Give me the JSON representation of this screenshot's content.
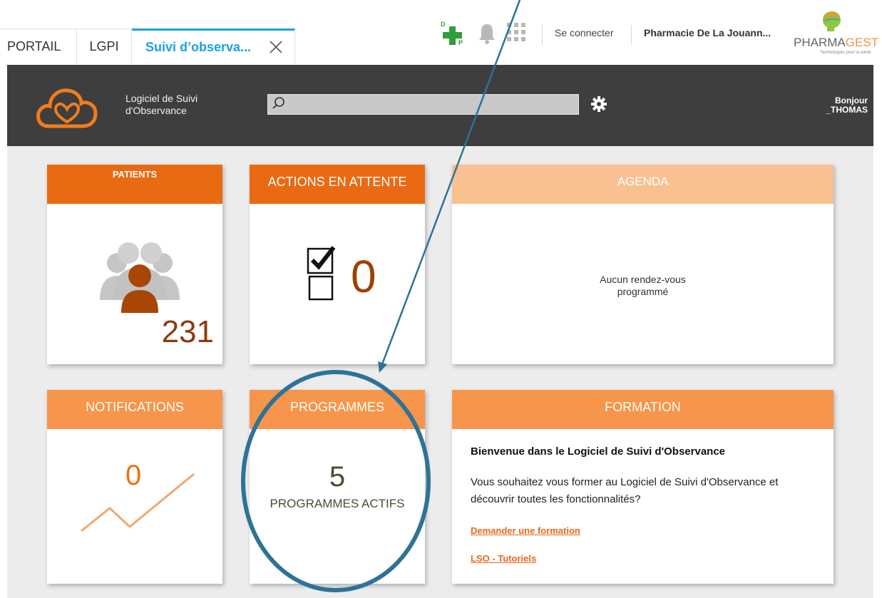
{
  "tabs": [
    {
      "label": "PORTAIL"
    },
    {
      "label": "LGPI"
    },
    {
      "label": "Suivi d’observa..."
    }
  ],
  "topbar": {
    "connect": "Se connecter",
    "pharmacy": "Pharmacie De La Jouann...",
    "logo_main": "PHARMA",
    "logo_accent": "GEST",
    "logo_sub": "Technologies pour la santé",
    "dp_letters": "D P"
  },
  "app": {
    "title_line1": "Logiciel de Suivi",
    "title_line2": "d'Observance",
    "search_value": "",
    "greeting": "Bonjour",
    "user": "_THOMAS"
  },
  "cards": {
    "patients": {
      "title": "PATIENTS",
      "count": "231"
    },
    "actions": {
      "title": "ACTIONS EN ATTENTE",
      "count": "0"
    },
    "agenda": {
      "title": "AGENDA",
      "message_line1": "Aucun rendez-vous",
      "message_line2": "programmé"
    },
    "notifications": {
      "title": "NOTIFICATIONS",
      "count": "0"
    },
    "programmes": {
      "title": "PROGRAMMES",
      "count": "5",
      "label": "PROGRAMMES ACTIFS"
    },
    "formation": {
      "title": "FORMATION",
      "heading": "Bienvenue dans le Logiciel de Suivi d'Observance",
      "text": "Vous souhaitez vous former au Logiciel de Suivi d'Observance et découvrir toutes les fonctionnalités?",
      "link1": "Demander une formation",
      "link2": "LSO - Tutoriels"
    }
  },
  "colors": {
    "accent_blue": "#1ba1e2",
    "orange_dark": "#ea6a13",
    "orange_mid": "#f6954b",
    "orange_light": "#f9c091",
    "header_dark": "#3e3e3e",
    "annotation": "#2e7396"
  }
}
